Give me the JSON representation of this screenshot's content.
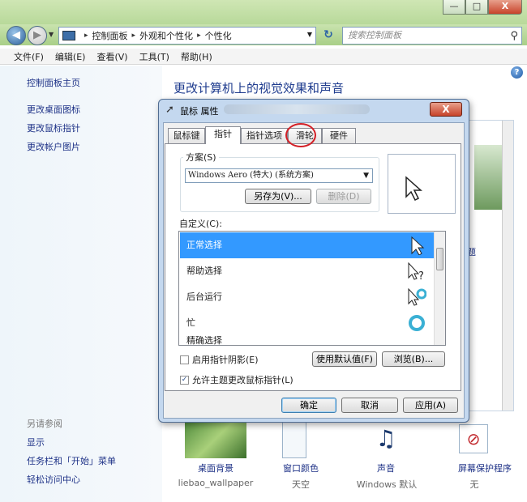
{
  "window": {
    "address_breadcrumbs": [
      "控制面板",
      "外观和个性化",
      "个性化"
    ],
    "search_placeholder": "搜索控制面板",
    "buttons": {
      "minimize": "—",
      "maximize": "□",
      "close": "X"
    }
  },
  "menu": [
    "文件(F)",
    "编辑(E)",
    "查看(V)",
    "工具(T)",
    "帮助(H)"
  ],
  "sidebar": {
    "links": [
      "控制面板主页",
      "更改桌面图标",
      "更改鼠标指针",
      "更改帐户图片"
    ],
    "see_also_heading": "另请参阅",
    "see_also": [
      "显示",
      "任务栏和「开始」菜单",
      "轻松访问中心"
    ]
  },
  "main": {
    "heading": "更改计算机上的视觉效果和声音",
    "theme_link": "主题"
  },
  "bottom_items": [
    {
      "label": "桌面背景",
      "sub": "liebao_wallpaper"
    },
    {
      "label": "窗口颜色",
      "sub": "天空"
    },
    {
      "label": "声音",
      "sub": "Windows 默认"
    },
    {
      "label": "屏幕保护程序",
      "sub": "无"
    }
  ],
  "dialog": {
    "title": "鼠标 属性",
    "close": "X",
    "tabs": [
      "鼠标键",
      "指针",
      "指针选项",
      "滑轮",
      "硬件"
    ],
    "active_tab": "指针",
    "highlighted_tab": "滑轮",
    "scheme_legend": "方案(S)",
    "scheme_value": "Windows Aero (特大) (系统方案)",
    "save_as": "另存为(V)...",
    "delete": "删除(D)",
    "custom_label": "自定义(C):",
    "cursor_rows": [
      "正常选择",
      "帮助选择",
      "后台运行",
      "忙",
      "精确选择"
    ],
    "selected_row": "正常选择",
    "shadow_checkbox": {
      "label": "启用指针阴影(E)",
      "checked": false
    },
    "use_default": "使用默认值(F)",
    "browse": "浏览(B)...",
    "theme_checkbox": {
      "label": "允许主题更改鼠标指针(L)",
      "checked": true
    },
    "ok": "确定",
    "cancel": "取消",
    "apply": "应用(A)"
  },
  "colors": {
    "selection": "#3399ff",
    "link": "#1e3287",
    "heading": "#1e3b8e",
    "highlight_ring": "#d31f26"
  }
}
